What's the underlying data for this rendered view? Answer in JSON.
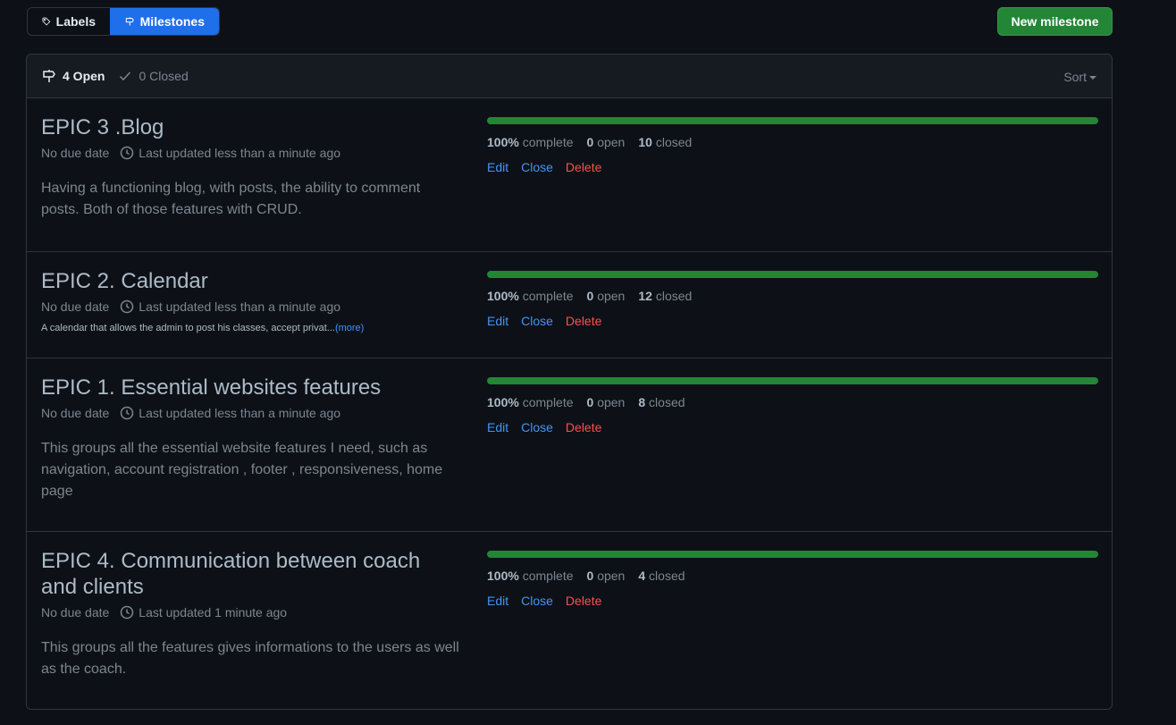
{
  "tabs": {
    "labels": "Labels",
    "milestones": "Milestones"
  },
  "new_milestone": "New milestone",
  "header": {
    "open_count": "4 Open",
    "closed_count": "0 Closed",
    "sort": "Sort"
  },
  "colors": {
    "accent": "#1f6feb",
    "success": "#238636",
    "danger": "#f85149",
    "link": "#4493f8"
  },
  "milestones": [
    {
      "title": "EPIC 3 .Blog",
      "due": "No due date",
      "updated": "Last updated less than a minute ago",
      "description": "Having a functioning blog, with posts, the ability to comment posts. Both of those features with CRUD.",
      "progress": 1.0,
      "percent": "100%",
      "complete_label": "complete",
      "open": "0",
      "open_label": "open",
      "closed": "10",
      "closed_label": "closed",
      "edit": "Edit",
      "close": "Close",
      "delete": "Delete"
    },
    {
      "title": "EPIC 2. Calendar",
      "due": "No due date",
      "updated": "Last updated less than a minute ago",
      "description": "A calendar that allows the admin to post his classes, accept privat...",
      "more": "(more)",
      "progress": 1.0,
      "percent": "100%",
      "complete_label": "complete",
      "open": "0",
      "open_label": "open",
      "closed": "12",
      "closed_label": "closed",
      "edit": "Edit",
      "close": "Close",
      "delete": "Delete"
    },
    {
      "title": "EPIC 1. Essential websites features",
      "due": "No due date",
      "updated": "Last updated less than a minute ago",
      "description": "This groups all the essential website features I need, such as navigation, account registration , footer , responsiveness, home page",
      "progress": 1.0,
      "percent": "100%",
      "complete_label": "complete",
      "open": "0",
      "open_label": "open",
      "closed": "8",
      "closed_label": "closed",
      "edit": "Edit",
      "close": "Close",
      "delete": "Delete"
    },
    {
      "title": "EPIC 4. Communication between coach and clients",
      "due": "No due date",
      "updated": "Last updated 1 minute ago",
      "description": "This groups all the features gives informations to the users as well as the coach.",
      "progress": 1.0,
      "percent": "100%",
      "complete_label": "complete",
      "open": "0",
      "open_label": "open",
      "closed": "4",
      "closed_label": "closed",
      "edit": "Edit",
      "close": "Close",
      "delete": "Delete"
    }
  ]
}
